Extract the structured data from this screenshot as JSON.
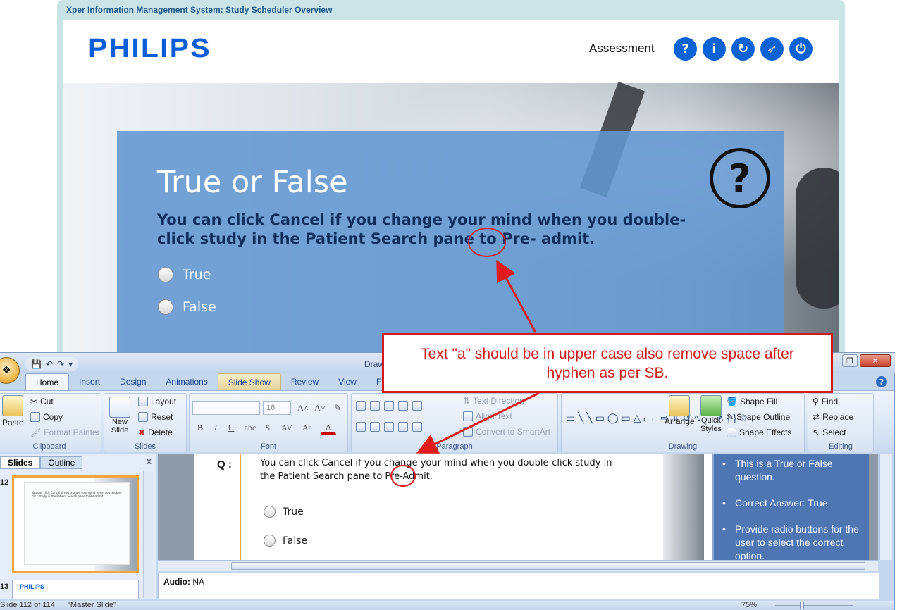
{
  "course": {
    "window_title": "Xper Information Management System: Study Scheduler Overview",
    "logo": "PHILIPS",
    "section": "Assessment",
    "nav_buttons": [
      {
        "name": "help",
        "glyph": "?"
      },
      {
        "name": "info",
        "glyph": "i"
      },
      {
        "name": "replay",
        "glyph": "↻"
      },
      {
        "name": "compass",
        "glyph": "➶"
      },
      {
        "name": "power",
        "glyph": "⏻"
      }
    ],
    "quiz": {
      "heading": "True or False",
      "question": "You can click Cancel if you change your mind when you double-click study in the Patient Search pane to Pre- admit.",
      "options": [
        "True",
        "False"
      ],
      "help_glyph": "?"
    }
  },
  "callout": {
    "text": "Text \"a\" should be in upper case also remove space after hyphen as per SB."
  },
  "ppt": {
    "title": "Draw",
    "qat": [
      "💾",
      "↶",
      "↷",
      "▾"
    ],
    "tabs": [
      "Home",
      "Insert",
      "Design",
      "Animations",
      "Slide Show",
      "Review",
      "View",
      "F"
    ],
    "help": "?",
    "ribbon": {
      "clipboard": {
        "label": "Clipboard",
        "paste": "Paste",
        "cut": "Cut",
        "copy": "Copy",
        "format_painter": "Format Painter"
      },
      "slides": {
        "label": "Slides",
        "new_slide": "New Slide",
        "layout": "Layout",
        "reset": "Reset",
        "delete": "Delete"
      },
      "font": {
        "label": "Font",
        "font_size": "16",
        "bold": "B",
        "italic": "I",
        "underline": "U",
        "strike": "abc",
        "shadow": "S",
        "spacing": "AV",
        "case": "Aa",
        "color": "A"
      },
      "paragraph": {
        "label": "Paragraph",
        "text_direction": "Text Direction",
        "align_text": "Align Text",
        "smartart": "Convert to SmartArt"
      },
      "drawing": {
        "label": "Drawing",
        "arrange": "Arrange",
        "quick_styles": "Quick Styles",
        "shape_fill": "Shape Fill",
        "shape_outline": "Shape Outline",
        "shape_effects": "Shape Effects"
      },
      "editing": {
        "label": "Editing",
        "find": "Find",
        "replace": "Replace",
        "select": "Select"
      }
    },
    "slides_pane": {
      "tabs": [
        "Slides",
        "Outline"
      ],
      "close": "x",
      "thumbs": [
        {
          "num": "12",
          "text": "You can click Cancel if you change your mind when you double-click study in the Patient Search pane to Pre-admit."
        },
        {
          "num": "13",
          "logo": "PHILIPS"
        }
      ]
    },
    "slide": {
      "q_label": "Q :",
      "question": "You can click Cancel if you change your mind when you double-click study in the Patient Search pane to Pre-Admit.",
      "options": [
        "True",
        "False"
      ]
    },
    "notes_panel": [
      "This is a True or False question.",
      "Correct Answer: True",
      "Provide radio buttons for the user to select the correct option."
    ],
    "notes": {
      "label": "Audio:",
      "value": "NA"
    },
    "status": {
      "slide_info": "Slide 112 of 114",
      "theme": "\"Master Slide\"",
      "zoom": "75%"
    }
  }
}
